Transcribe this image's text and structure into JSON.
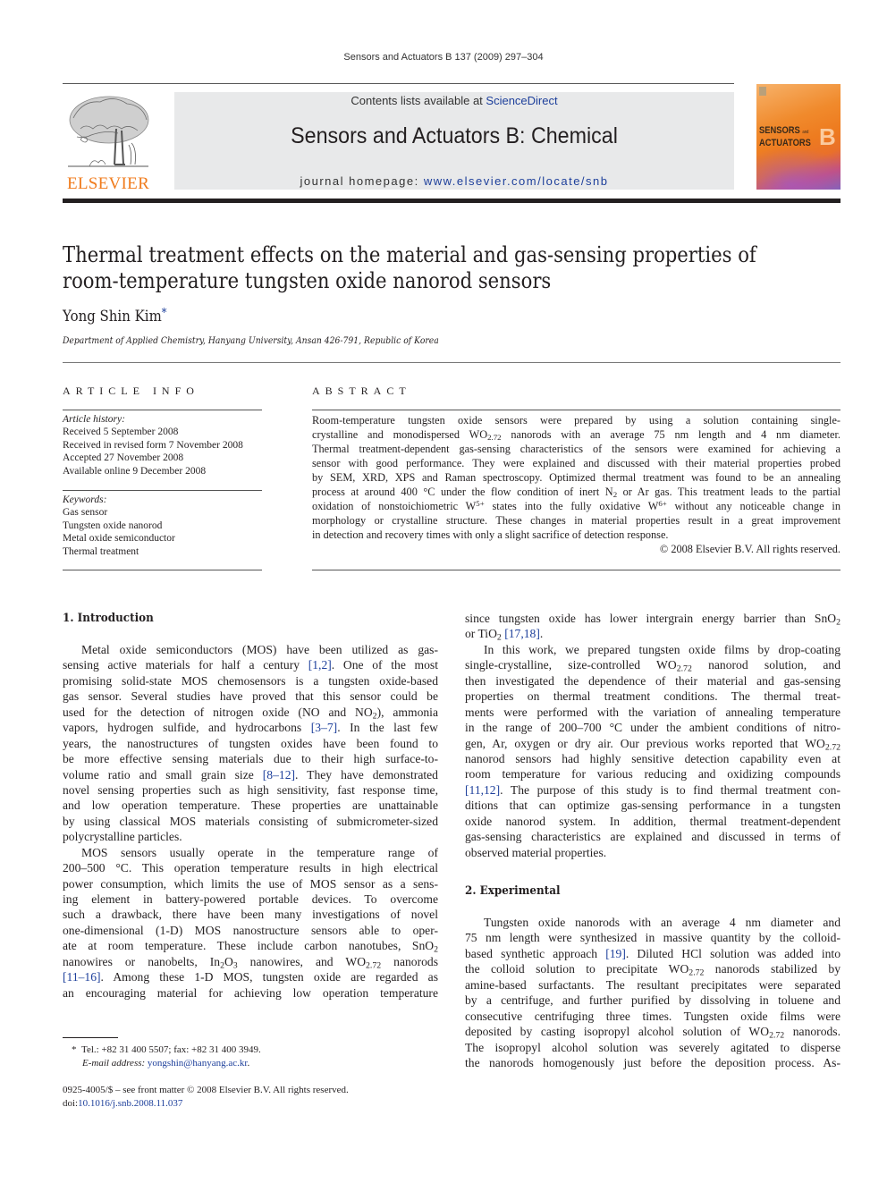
{
  "running_head": "Sensors and Actuators B 137 (2009) 297–304",
  "publisher": {
    "wordmark": "ELSEVIER",
    "logo_icon": "elsevier-tree-icon"
  },
  "masthead": {
    "contents_prefix": "Contents lists available at ",
    "contents_link": "ScienceDirect",
    "journal_title": "Sensors and Actuators B: Chemical",
    "homepage_prefix": "journal homepage: ",
    "homepage_link": "www.elsevier.com/locate/snb"
  },
  "cover": {
    "line1": "SENSORS",
    "and": "and",
    "line2": "ACTUATORS",
    "letter": "B"
  },
  "colors": {
    "link": "#1d3f9b",
    "elsevier_orange": "#f07b1c",
    "masthead_bg": "#e8e9ea"
  },
  "article": {
    "title_lines": [
      "Thermal treatment effects on the material and gas-sensing properties of",
      "room-temperature tungsten oxide nanorod sensors"
    ],
    "author": "Yong Shin Kim",
    "author_mark": "*",
    "affiliation": "Department of Applied Chemistry, Hanyang University, Ansan 426-791, Republic of Korea"
  },
  "article_info": {
    "heading": "ARTICLE INFO",
    "history_label": "Article history:",
    "history": [
      "Received 5 September 2008",
      "Received in revised form 7 November 2008",
      "Accepted 27 November 2008",
      "Available online 9 December 2008"
    ],
    "keywords_label": "Keywords:",
    "keywords": [
      "Gas sensor",
      "Tungsten oxide nanorod",
      "Metal oxide semiconductor",
      "Thermal treatment"
    ]
  },
  "abstract": {
    "heading": "ABSTRACT",
    "lines": [
      "Room-temperature tungsten oxide sensors were prepared by using a solution containing single-",
      "crystalline and monodispersed WO<sub>2.72</sub> nanorods with an average 75 nm length and 4 nm diameter.",
      "Thermal treatment-dependent gas-sensing characteristics of the sensors were examined for achieving a",
      "sensor with good performance. They were explained and discussed with their material properties probed",
      "by SEM, XRD, XPS and Raman spectroscopy. Optimized thermal treatment was found to be an annealing",
      "process at around 400 °C under the flow condition of inert N<sub>2</sub> or Ar gas. This treatment leads to the partial",
      "oxidation of nonstoichiometric W<sup>5+</sup> states into the fully oxidative W<sup>6+</sup> without any noticeable change in",
      "morphology or crystalline structure. These changes in material properties result in a great improvement",
      "in detection and recovery times with only a slight sacrifice of detection response."
    ],
    "copyright": "© 2008 Elsevier B.V. All rights reserved."
  },
  "body": {
    "sections": [
      {
        "heading": "1.  Introduction"
      },
      {
        "heading": "2.  Experimental"
      }
    ],
    "left_column_lines": [
      "Metal oxide semiconductors (MOS) have been utilized as gas-",
      "sensing active materials for half a century <span class=\"ref\">[1,2]</span>. One of the most",
      "promising solid-state MOS chemosensors is a tungsten oxide-based",
      "gas sensor. Several studies have proved that this sensor could be",
      "used for the detection of nitrogen oxide (NO and NO<sub>2</sub>), ammonia",
      "vapors, hydrogen sulfide, and hydrocarbons <span class=\"ref\">[3–7]</span>. In the last few",
      "years, the nanostructures of tungsten oxides have been found to",
      "be more effective sensing materials due to their high surface-to-",
      "volume ratio and small grain size <span class=\"ref\">[8–12]</span>. They have demonstrated",
      "novel sensing properties such as high sensitivity, fast response time,",
      "and low operation temperature. These properties are unattainable",
      "by using classical MOS materials consisting of submicrometer-sized",
      "polycrystalline particles.",
      "MOS sensors usually operate in the temperature range of",
      "200–500 °C. This operation temperature results in high electrical",
      "power consumption, which limits the use of MOS sensor as a sens-",
      "ing element in battery-powered portable devices. To overcome",
      "such a drawback, there have been many investigations of novel",
      "one-dimensional (1-D) MOS nanostructure sensors able to oper-",
      "ate at room temperature. These include carbon nanotubes, SnO<sub>2</sub>",
      "nanowires or nanobelts, In<sub>2</sub>O<sub>3</sub> nanowires, and WO<sub>2.72</sub> nanorods",
      "<span class=\"ref\">[11–16]</span>. Among these 1-D MOS, tungsten oxide are regarded as",
      "an encouraging material for achieving low operation temperature"
    ],
    "right_column_intro_lines": [
      "since tungsten oxide has lower intergrain energy barrier than SnO<sub>2</sub>",
      "or TiO<sub>2</sub> <span class=\"ref\">[17,18]</span>.",
      "In this work, we prepared tungsten oxide films by drop-coating",
      "single-crystalline, size-controlled WO<sub>2.72</sub> nanorod solution, and",
      "then investigated the dependence of their material and gas-sensing",
      "properties on thermal treatment conditions. The thermal treat-",
      "ments were performed with the variation of annealing temperature",
      "in the range of 200–700 °C under the ambient conditions of nitro-",
      "gen, Ar, oxygen or dry air. Our previous works reported that WO<sub>2.72</sub>",
      "nanorod sensors had highly sensitive detection capability even at",
      "room temperature for various reducing and oxidizing compounds",
      "<span class=\"ref\">[11,12]</span>. The purpose of this study is to find thermal treatment con-",
      "ditions that can optimize gas-sensing performance in a tungsten",
      "oxide nanorod system. In addition, thermal treatment-dependent",
      "gas-sensing characteristics are explained and discussed in terms of",
      "observed material properties."
    ],
    "right_column_exp_lines": [
      "Tungsten oxide nanorods with an average 4 nm diameter and",
      "75 nm length were synthesized in massive quantity by the colloid-",
      "based synthetic approach <span class=\"ref\">[19]</span>. Diluted HCl solution was added into",
      "the colloid solution to precipitate WO<sub>2.72</sub> nanorods stabilized by",
      "amine-based surfactants. The resultant precipitates were separated",
      "by a centrifuge, and further purified by dissolving in toluene and",
      "consecutive centrifuging three times. Tungsten oxide films were",
      "deposited by casting isopropyl alcohol solution of WO<sub>2.72</sub> nanorods.",
      "The isopropyl alcohol solution was severely agitated to disperse",
      "the nanorods homogenously just before the deposition process. As-"
    ]
  },
  "footnote": {
    "mark": "*",
    "contact": "Tel.: +82 31 400 5507; fax: +82 31 400 3949.",
    "email_label": "E-mail address: ",
    "email": "yongshin@hanyang.ac.kr"
  },
  "footer": {
    "issn_line": "0925-4005/$ – see front matter © 2008 Elsevier B.V. All rights reserved.",
    "doi_label": "doi:",
    "doi": "10.1016/j.snb.2008.11.037"
  }
}
